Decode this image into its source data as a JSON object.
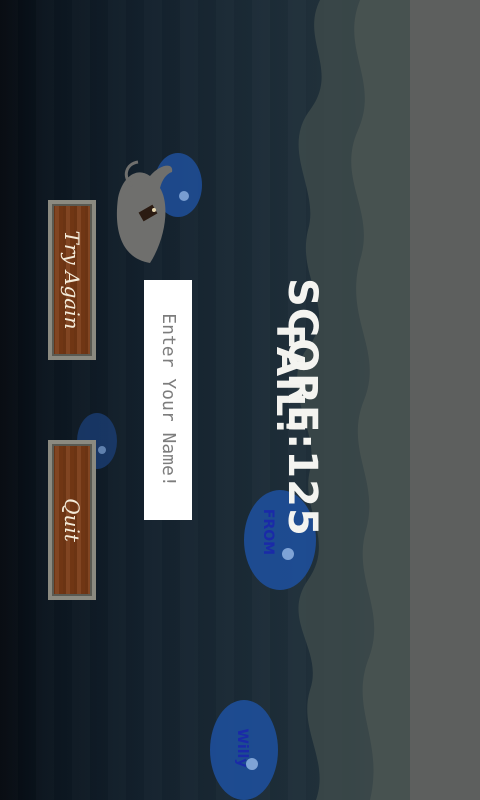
{
  "game": {
    "result_title": "FAIL!",
    "score_text": "SCORE:125",
    "name_input_placeholder": "Enter Your Name!",
    "buttons": {
      "try_again": "Try Again",
      "quit": "Quit"
    },
    "bubble_words": {
      "from": "FROM",
      "willy": "Willy"
    }
  },
  "icons": [
    "whale-icon",
    "water-bubble-icon",
    "wave-icon"
  ],
  "colors": {
    "background_dark": "#05090f",
    "background_light": "#2e3c42",
    "button_wood": "#7a3b16",
    "button_border": "#8b8a80",
    "bubble_blue": "#1e4f9a",
    "bubble_text": "#1a2aa8",
    "title_text": "#f2f2ee",
    "fog": "#5d5f5e"
  }
}
